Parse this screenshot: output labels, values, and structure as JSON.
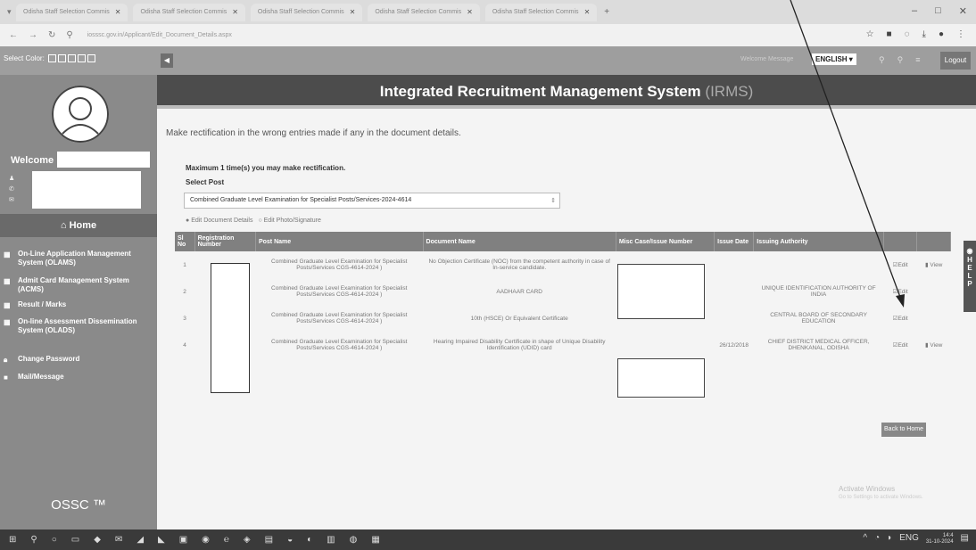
{
  "browser": {
    "tabs": [
      "Odisha Staff Selection Commis",
      "Odisha Staff Selection Commis",
      "Odisha Staff Selection Commis",
      "Odisha Staff Selection Commis",
      "Odisha Staff Selection Commis"
    ],
    "url": "iosssc.gov.in/Applicant/Edit_Document_Details.aspx"
  },
  "topbar": {
    "select_color": "Select Color:",
    "welcome_message": "Welcome Message",
    "language": "ENGLISH ▾",
    "logout": "Logout"
  },
  "sidebar": {
    "welcome": "Welcome",
    "home": "Home",
    "menu": [
      {
        "label": "On-Line Application Management System (OLAMS)"
      },
      {
        "label": "Admit Card Management System (ACMS)"
      },
      {
        "label": "Result / Marks"
      },
      {
        "label": "On-line Assessment Dissemination System (OLADS)"
      },
      {
        "label": "Change Password"
      },
      {
        "label": "Mail/Message"
      }
    ],
    "brand": "OSSC ™"
  },
  "main": {
    "banner_title": "Integrated Recruitment Management System",
    "banner_abbr": "(IRMS)",
    "instruction": "Make rectification in the wrong entries made if any in the document details.",
    "max_times": "Maximum 1 time(s) you may make rectification.",
    "select_post_label": "Select Post",
    "select_post_value": "Combined Graduate Level Examination for Specialist Posts/Services-2024-4614",
    "radio_edit_document": "Edit Document Details",
    "radio_edit_photo": "Edit Photo/Signature",
    "back_to_home": "Back to Home",
    "activate_windows": "Activate Windows",
    "activate_sub": "Go to Settings to activate Windows."
  },
  "table": {
    "headers": [
      "Sl No",
      "Registration Number",
      "Post Name",
      "Document Name",
      "Misc Case/Issue Number",
      "Issue Date",
      "Issuing Authority",
      "",
      ""
    ],
    "rows": [
      {
        "sl": "1",
        "post": "Combined Graduate Level Examination for Specialist Posts/Services CGS-4614-2024 )",
        "doc": "No Objection Certificate (NOC) from the competent authority in case of In-service candidate.",
        "date": "",
        "authority": "",
        "edit": "Edit",
        "view": "View"
      },
      {
        "sl": "2",
        "post": "Combined Graduate Level Examination for Specialist Posts/Services CGS-4614-2024 )",
        "doc": "AADHAAR CARD",
        "date": "",
        "authority": "UNIQUE IDENTIFICATION AUTHORITY OF INDIA",
        "edit": "Edit",
        "view": ""
      },
      {
        "sl": "3",
        "post": "Combined Graduate Level Examination for Specialist Posts/Services CGS-4614-2024 )",
        "doc": "10th (HSCE) Or Equivalent Certificate",
        "date": "",
        "authority": "CENTRAL BOARD OF SECONDARY EDUCATION",
        "edit": "Edit",
        "view": ""
      },
      {
        "sl": "4",
        "post": "Combined Graduate Level Examination for Specialist Posts/Services CGS-4614-2024 )",
        "doc": "Hearing Impaired Disability Certificate in shape of Unique Disability Identification (UDID) card",
        "date": "26/12/2018",
        "authority": "CHIEF DISTRICT MEDICAL OFFICER, DHENKANAL, ODISHA",
        "edit": "Edit",
        "view": "View"
      }
    ]
  },
  "help": "HELP",
  "taskbar": {
    "lang": "ENG",
    "time": "14:4",
    "date": "31-10-2024"
  },
  "colors": {
    "banner": "#4c4c4c",
    "sidebar": "#8a8a8a",
    "table_header": "#808080"
  }
}
